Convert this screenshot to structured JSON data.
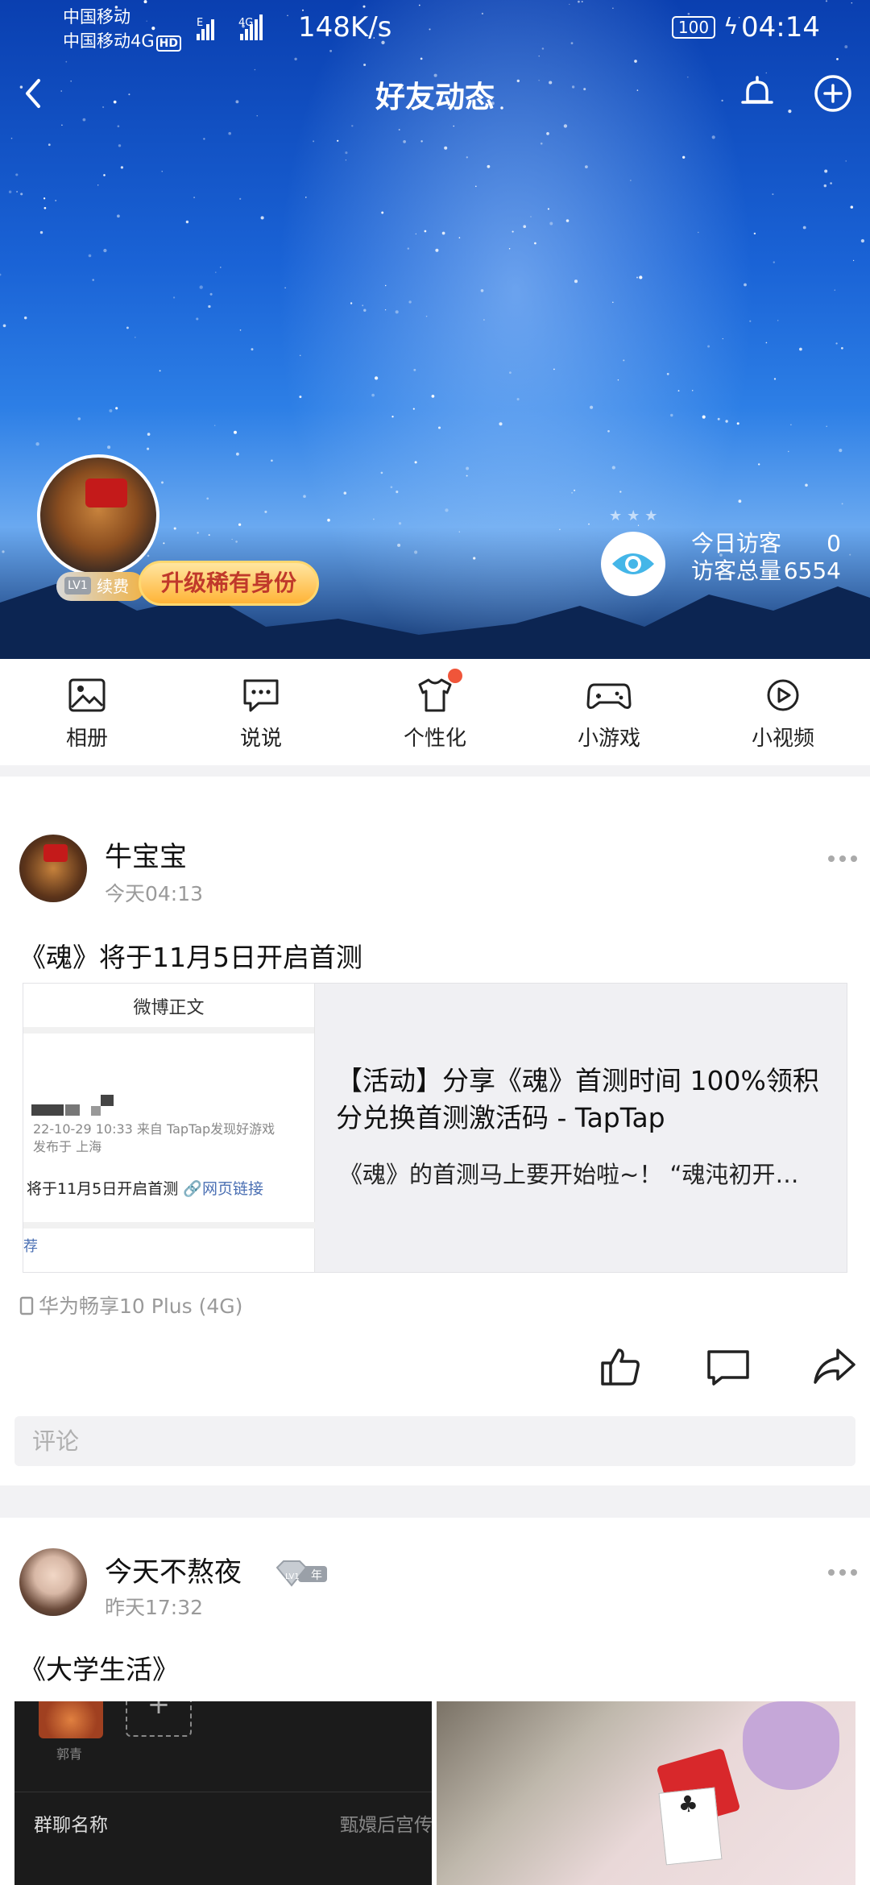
{
  "status_bar": {
    "carrier_line1": "中国移动",
    "carrier_line2": "中国移动4G",
    "hd": "HD",
    "net_type": "4G",
    "net_speed": "148K/s",
    "battery": "100",
    "time": "04:14"
  },
  "nav": {
    "title": "好友动态"
  },
  "profile": {
    "level": "LV1",
    "renew_label": "续费",
    "upgrade_label": "升级稀有身份",
    "visitors_today_label": "今日访客",
    "visitors_today": "0",
    "visitors_total_label": "访客总量",
    "visitors_total": "6554"
  },
  "features": [
    {
      "label": "相册",
      "icon": "album-icon"
    },
    {
      "label": "说说",
      "icon": "chat-icon"
    },
    {
      "label": "个性化",
      "icon": "tshirt-icon"
    },
    {
      "label": "小游戏",
      "icon": "gamepad-icon"
    },
    {
      "label": "小视频",
      "icon": "video-icon"
    }
  ],
  "posts": [
    {
      "author": "牛宝宝",
      "time": "今天04:13",
      "text": "《魂》将于11月5日开启首测",
      "link": {
        "thumb_header": "微博正文",
        "thumb_meta1": "22-10-29 10:33  来自 TapTap发现好游戏",
        "thumb_meta2": "发布于 上海",
        "thumb_line": "将于11月5日开启首测",
        "thumb_link": "网页链接",
        "thumb_rec": "荐",
        "title": "【活动】分享《魂》首测时间 100%领积分兑换首测激活码 - TapTap",
        "desc": "《魂》的首测马上要开始啦~！ “魂沌初开…"
      },
      "device": "华为畅享10 Plus (4G)",
      "comment_placeholder": "评论"
    },
    {
      "author": "今天不熬夜",
      "time": "昨天17:32",
      "badge_level": "LV1",
      "badge_text": "年",
      "text": "《大学生活》",
      "photo_a": {
        "sub": "郭青",
        "row_label": "群聊名称",
        "row_value": "甄嬛后宫传"
      }
    }
  ]
}
